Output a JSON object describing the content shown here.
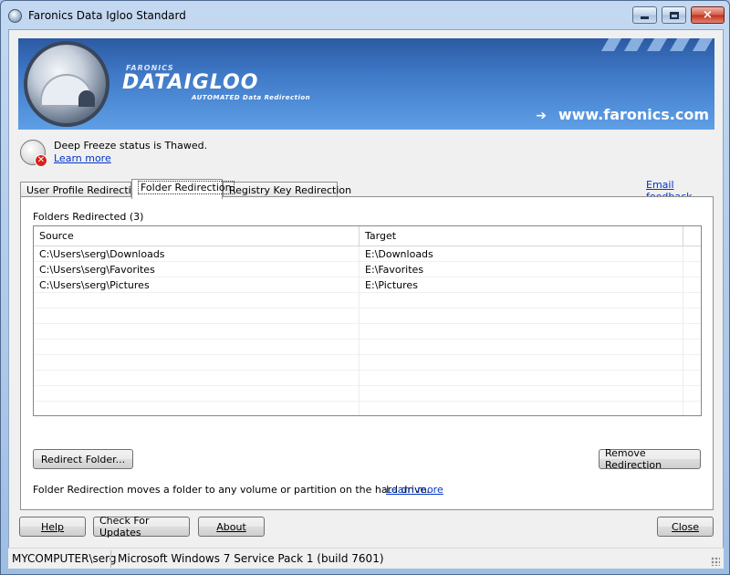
{
  "window": {
    "title": "Faronics Data Igloo Standard",
    "controls": {
      "minimize": "minimize",
      "maximize": "maximize",
      "close": "×"
    }
  },
  "banner": {
    "brand_small": "FARONICS",
    "brand_big": "DATAIGLOO",
    "brand_sub": "AUTOMATED Data Redirection",
    "website": "www.faronics.com",
    "colors": {
      "gradient_top": "#2c5aa3",
      "gradient_bottom": "#5f9fe6"
    }
  },
  "deep_freeze": {
    "icon": "deep-freeze-bear-icon",
    "badge_icon": "error-x-icon",
    "status": "Deep Freeze status is Thawed.",
    "learn_more": "Learn more"
  },
  "email_feedback": "Email feedback",
  "tabs": [
    {
      "label": "User Profile Redirection",
      "active": false
    },
    {
      "label": "Folder Redirection",
      "active": true
    },
    {
      "label": "Registry Key Redirection",
      "active": false
    }
  ],
  "folder_panel": {
    "heading": "Folders Redirected (3)",
    "columns": {
      "source": "Source",
      "target": "Target"
    },
    "rows": [
      {
        "source": "C:\\Users\\serg\\Downloads",
        "target": "E:\\Downloads"
      },
      {
        "source": "C:\\Users\\serg\\Favorites",
        "target": "E:\\Favorites"
      },
      {
        "source": "C:\\Users\\serg\\Pictures",
        "target": "E:\\Pictures"
      }
    ],
    "redirect_button": "Redirect Folder...",
    "remove_button": "Remove Redirection",
    "description": "Folder Redirection moves a folder to any volume or partition on the hard drive.",
    "learn_more": "Learn more"
  },
  "footer_buttons": {
    "help": "Help",
    "updates": "Check For Updates",
    "about": "About",
    "close": "Close"
  },
  "statusbar": {
    "user": "MYCOMPUTER\\serg",
    "os": "Microsoft Windows 7  Service Pack 1 (build 7601)"
  }
}
